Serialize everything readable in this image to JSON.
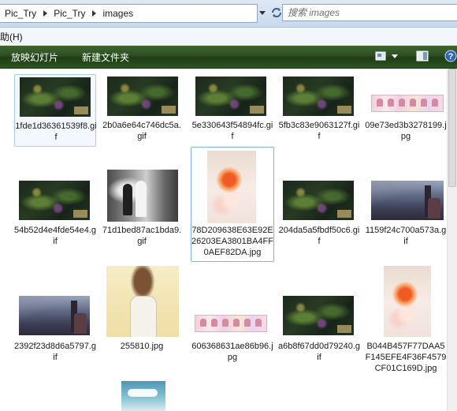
{
  "address": {
    "crumbs": [
      "Pic_Try",
      "Pic_Try",
      "images"
    ],
    "search_placeholder": "搜索 images"
  },
  "menubar": {
    "help": "助(H)"
  },
  "toolbar": {
    "slideshow": "放映幻灯片",
    "new_folder": "新建文件夹"
  },
  "files": [
    {
      "name": "1fde1d36361539f8.gif",
      "thumb": "game"
    },
    {
      "name": "2b0a6e64c746dc5a.gif",
      "thumb": "game"
    },
    {
      "name": "5e330643f54894fc.gif",
      "thumb": "game"
    },
    {
      "name": "5fb3c83e9063127f.gif",
      "thumb": "game"
    },
    {
      "name": "09e73ed3b3278199.jpg",
      "thumb": "banner"
    },
    {
      "name": "54b52d4e4fde54e4.gif",
      "thumb": "game"
    },
    {
      "name": "71d1bed87ac1bda9.gif",
      "thumb": "bw"
    },
    {
      "name": "78D209638E63E92E26203EA3801BA4FF0AEF82DA.jpg",
      "thumb": "fish"
    },
    {
      "name": "204da5a5fbdf50c6.gif",
      "thumb": "game"
    },
    {
      "name": "1159f24c700a573a.gif",
      "thumb": "street"
    },
    {
      "name": "2392f23d8d6a5797.gif",
      "thumb": "street"
    },
    {
      "name": "255810.jpg",
      "thumb": "anime"
    },
    {
      "name": "606368631ae86b96.jpg",
      "thumb": "banner"
    },
    {
      "name": "a6b8f67dd0d79240.gif",
      "thumb": "game"
    },
    {
      "name": "B044B457F77DAA5F145EFE4F36F4579CF01C169D.jpg",
      "thumb": "fish"
    },
    {
      "name": "",
      "thumb": "sky"
    }
  ]
}
